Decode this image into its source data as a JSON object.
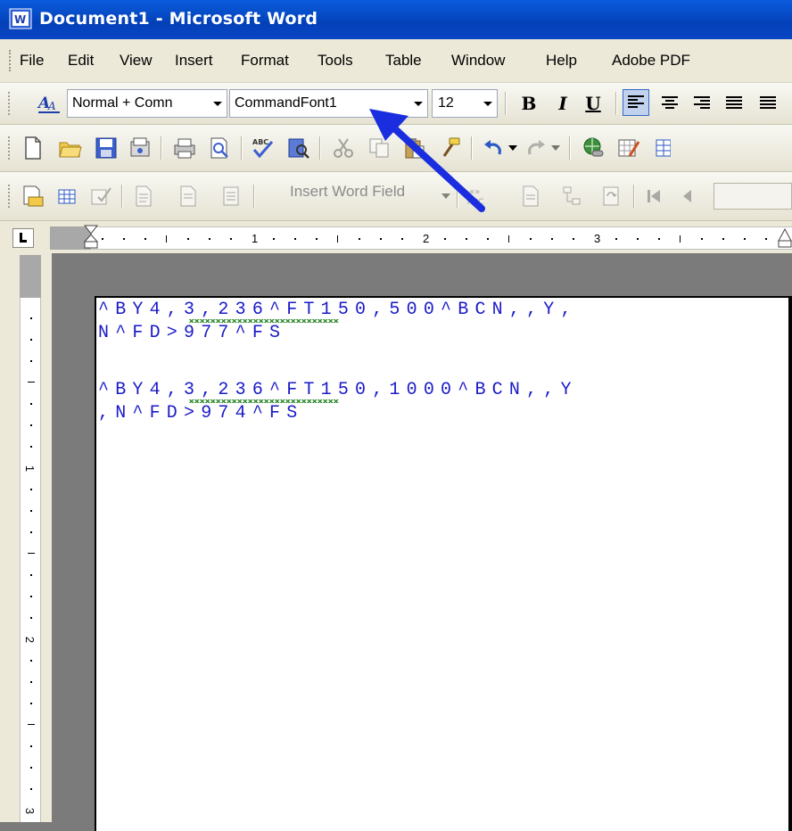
{
  "window": {
    "title": "Document1 - Microsoft Word"
  },
  "menu": {
    "items": [
      "File",
      "Edit",
      "View",
      "Insert",
      "Format",
      "Tools",
      "Table",
      "Window",
      "Help",
      "Adobe PDF"
    ]
  },
  "formatting": {
    "style_value": "Normal + Comn",
    "font_value": "CommandFont1",
    "size_value": "12",
    "bold_label": "B",
    "italic_label": "I",
    "underline_label": "U"
  },
  "mail_merge": {
    "insert_word_field_label": "Insert Word Field"
  },
  "ruler": {
    "h_numbers": [
      "1",
      "2",
      "3"
    ],
    "v_numbers": [
      "1",
      "2",
      "3"
    ]
  },
  "document": {
    "lines": [
      "^BY4,3,236^FT150,500^BCN,,Y,",
      "N^FD>977^FS",
      "^BY4,3,236^FT150,1000^BCN,,Y",
      ",N^FD>974^FS"
    ]
  },
  "colors": {
    "title_bar": "#0a5cdc",
    "text_blue": "#1a1ac8",
    "annotation_arrow": "#1a2ee0"
  }
}
